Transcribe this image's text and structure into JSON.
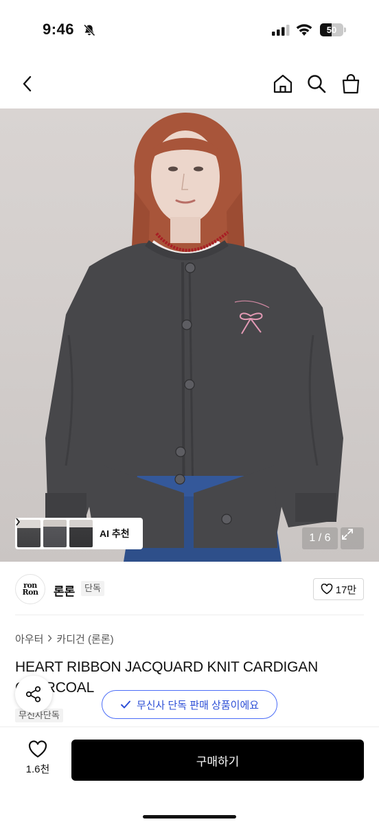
{
  "status_bar": {
    "time": "9:46",
    "battery": "50",
    "battery_level": 0.5,
    "icons": [
      "bell-slash-icon",
      "signal-icon",
      "wifi-icon",
      "battery-icon"
    ]
  },
  "nav": {
    "icons": [
      "chevron-left-icon",
      "home-icon",
      "search-icon",
      "shopping-bag-icon"
    ]
  },
  "gallery": {
    "ai_label": "AI 추천",
    "counter": "1 / 6",
    "icons": [
      "chevron-right-icon",
      "expand-icon"
    ]
  },
  "brand": {
    "logo_text_top": "ron",
    "logo_text_bottom": "Ron",
    "name": "론론",
    "badge": "단독",
    "likes": "17만"
  },
  "product": {
    "breadcrumb": [
      "아우터",
      "카디건 (론론)"
    ],
    "title_line1": "HEART RIBBON JACQUARD KNIT CARDIGAN",
    "title_line2": "CHARCOAL",
    "exclusive_badge": "무신사단독"
  },
  "toast": {
    "text": "무신사 단독 판매 상품이에요"
  },
  "bottom_bar": {
    "like_count": "1.6천",
    "buy_label": "구매하기"
  },
  "colors": {
    "accent_blue": "#4a6cf7",
    "buy_button": "#000000",
    "cardigan": "#47474a"
  }
}
